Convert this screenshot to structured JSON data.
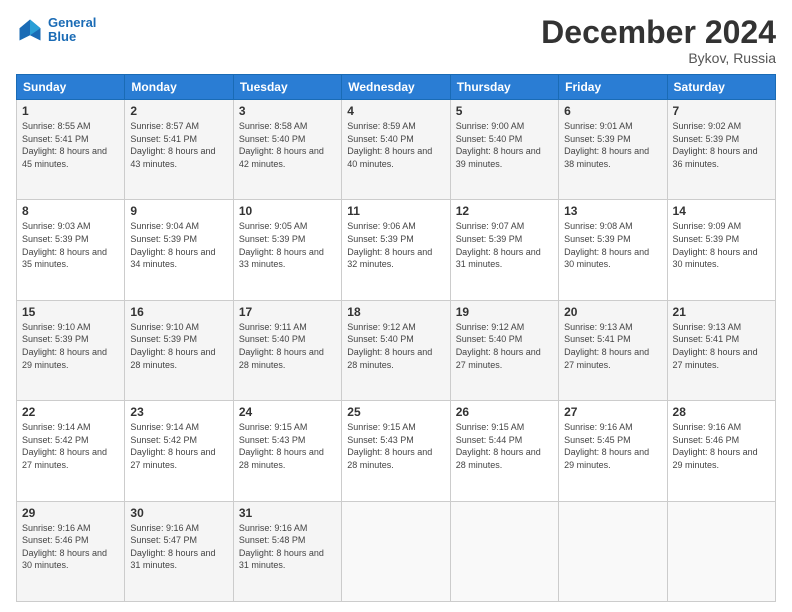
{
  "logo": {
    "line1": "General",
    "line2": "Blue"
  },
  "title": "December 2024",
  "location": "Bykov, Russia",
  "days_header": [
    "Sunday",
    "Monday",
    "Tuesday",
    "Wednesday",
    "Thursday",
    "Friday",
    "Saturday"
  ],
  "weeks": [
    [
      {
        "num": "1",
        "rise": "8:55 AM",
        "set": "5:41 PM",
        "daylight": "8 hours and 45 minutes."
      },
      {
        "num": "2",
        "rise": "8:57 AM",
        "set": "5:41 PM",
        "daylight": "8 hours and 43 minutes."
      },
      {
        "num": "3",
        "rise": "8:58 AM",
        "set": "5:40 PM",
        "daylight": "8 hours and 42 minutes."
      },
      {
        "num": "4",
        "rise": "8:59 AM",
        "set": "5:40 PM",
        "daylight": "8 hours and 40 minutes."
      },
      {
        "num": "5",
        "rise": "9:00 AM",
        "set": "5:40 PM",
        "daylight": "8 hours and 39 minutes."
      },
      {
        "num": "6",
        "rise": "9:01 AM",
        "set": "5:39 PM",
        "daylight": "8 hours and 38 minutes."
      },
      {
        "num": "7",
        "rise": "9:02 AM",
        "set": "5:39 PM",
        "daylight": "8 hours and 36 minutes."
      }
    ],
    [
      {
        "num": "8",
        "rise": "9:03 AM",
        "set": "5:39 PM",
        "daylight": "8 hours and 35 minutes."
      },
      {
        "num": "9",
        "rise": "9:04 AM",
        "set": "5:39 PM",
        "daylight": "8 hours and 34 minutes."
      },
      {
        "num": "10",
        "rise": "9:05 AM",
        "set": "5:39 PM",
        "daylight": "8 hours and 33 minutes."
      },
      {
        "num": "11",
        "rise": "9:06 AM",
        "set": "5:39 PM",
        "daylight": "8 hours and 32 minutes."
      },
      {
        "num": "12",
        "rise": "9:07 AM",
        "set": "5:39 PM",
        "daylight": "8 hours and 31 minutes."
      },
      {
        "num": "13",
        "rise": "9:08 AM",
        "set": "5:39 PM",
        "daylight": "8 hours and 30 minutes."
      },
      {
        "num": "14",
        "rise": "9:09 AM",
        "set": "5:39 PM",
        "daylight": "8 hours and 30 minutes."
      }
    ],
    [
      {
        "num": "15",
        "rise": "9:10 AM",
        "set": "5:39 PM",
        "daylight": "8 hours and 29 minutes."
      },
      {
        "num": "16",
        "rise": "9:10 AM",
        "set": "5:39 PM",
        "daylight": "8 hours and 28 minutes."
      },
      {
        "num": "17",
        "rise": "9:11 AM",
        "set": "5:40 PM",
        "daylight": "8 hours and 28 minutes."
      },
      {
        "num": "18",
        "rise": "9:12 AM",
        "set": "5:40 PM",
        "daylight": "8 hours and 28 minutes."
      },
      {
        "num": "19",
        "rise": "9:12 AM",
        "set": "5:40 PM",
        "daylight": "8 hours and 27 minutes."
      },
      {
        "num": "20",
        "rise": "9:13 AM",
        "set": "5:41 PM",
        "daylight": "8 hours and 27 minutes."
      },
      {
        "num": "21",
        "rise": "9:13 AM",
        "set": "5:41 PM",
        "daylight": "8 hours and 27 minutes."
      }
    ],
    [
      {
        "num": "22",
        "rise": "9:14 AM",
        "set": "5:42 PM",
        "daylight": "8 hours and 27 minutes."
      },
      {
        "num": "23",
        "rise": "9:14 AM",
        "set": "5:42 PM",
        "daylight": "8 hours and 27 minutes."
      },
      {
        "num": "24",
        "rise": "9:15 AM",
        "set": "5:43 PM",
        "daylight": "8 hours and 28 minutes."
      },
      {
        "num": "25",
        "rise": "9:15 AM",
        "set": "5:43 PM",
        "daylight": "8 hours and 28 minutes."
      },
      {
        "num": "26",
        "rise": "9:15 AM",
        "set": "5:44 PM",
        "daylight": "8 hours and 28 minutes."
      },
      {
        "num": "27",
        "rise": "9:16 AM",
        "set": "5:45 PM",
        "daylight": "8 hours and 29 minutes."
      },
      {
        "num": "28",
        "rise": "9:16 AM",
        "set": "5:46 PM",
        "daylight": "8 hours and 29 minutes."
      }
    ],
    [
      {
        "num": "29",
        "rise": "9:16 AM",
        "set": "5:46 PM",
        "daylight": "8 hours and 30 minutes."
      },
      {
        "num": "30",
        "rise": "9:16 AM",
        "set": "5:47 PM",
        "daylight": "8 hours and 31 minutes."
      },
      {
        "num": "31",
        "rise": "9:16 AM",
        "set": "5:48 PM",
        "daylight": "8 hours and 31 minutes."
      },
      null,
      null,
      null,
      null
    ]
  ]
}
